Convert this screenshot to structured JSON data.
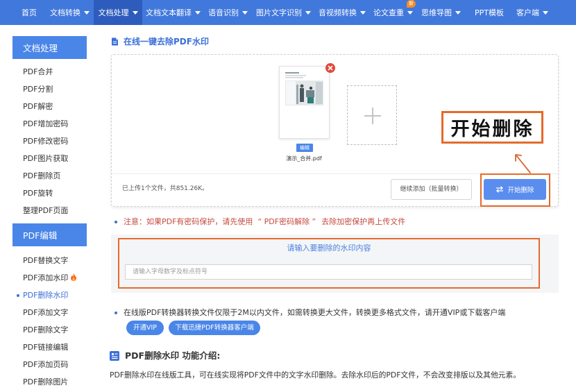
{
  "nav": {
    "items": [
      {
        "label": "首页",
        "dropdown": false
      },
      {
        "label": "文档转换",
        "dropdown": true
      },
      {
        "label": "文档处理",
        "dropdown": true,
        "active": true
      },
      {
        "label": "文档文本翻译",
        "dropdown": true
      },
      {
        "label": "语音识别",
        "dropdown": true
      },
      {
        "label": "图片文字识别",
        "dropdown": true
      },
      {
        "label": "音视频转换",
        "dropdown": true
      },
      {
        "label": "论文查重",
        "dropdown": true,
        "badge": "新"
      },
      {
        "label": "思维导图",
        "dropdown": true
      },
      {
        "label": "PPT模板",
        "dropdown": false
      },
      {
        "label": "客户端",
        "dropdown": true
      }
    ]
  },
  "sidebar": {
    "sections": [
      {
        "title": "文档处理",
        "items": [
          {
            "label": "PDF合并"
          },
          {
            "label": "PDF分割"
          },
          {
            "label": "PDF解密"
          },
          {
            "label": "PDF增加密码"
          },
          {
            "label": "PDF修改密码"
          },
          {
            "label": "PDF图片获取"
          },
          {
            "label": "PDF删除页"
          },
          {
            "label": "PDF旋转"
          },
          {
            "label": "整理PDF页面"
          }
        ]
      },
      {
        "title": "PDF编辑",
        "items": [
          {
            "label": "PDF替换文字"
          },
          {
            "label": "PDF添加水印",
            "icon": "fire-icon"
          },
          {
            "label": "PDF删除水印",
            "active": true
          },
          {
            "label": "PDF添加文字"
          },
          {
            "label": "PDF删除文字"
          },
          {
            "label": "PDF链接编辑"
          },
          {
            "label": "PDF添加页码"
          },
          {
            "label": "PDF删除图片"
          }
        ]
      }
    ]
  },
  "page_title": "在线一键去除PDF水印",
  "upload": {
    "file": {
      "name": "演示_合并.pdf",
      "edit_label": "编辑"
    },
    "status": "已上传1个文件，共851.26K。",
    "add_more_label": "继续添加（批量转换）",
    "start_label": "开始删除"
  },
  "annotation": {
    "label": "开始删除"
  },
  "notice": {
    "prefix": "注意：如果PDF有密码保护，请先使用",
    "link": "“ PDF密码解除 ”",
    "suffix": "去除加密保护再上传文件"
  },
  "watermark": {
    "title": "请输入要删除的水印内容",
    "placeholder": "请输入字母数字及标点符号"
  },
  "limit_notice": "在线版PDF转换器转换文件仅限于2M以内文件，如需转换更大文件，转换更多格式文件，请开通VIP或下载客户端",
  "cta": {
    "vip_label": "开通VIP",
    "download_label": "下载迅捷PDF转换器客户端"
  },
  "intro": {
    "heading": "PDF删除水印 功能介绍:",
    "body": "PDF删除水印在线版工具，可在线实现将PDF文件中的文字水印删除。去除水印后的PDF文件，不会改变排版以及其他元素。"
  },
  "colors": {
    "nav": "#4178dc",
    "nav_active": "#2d5cbd",
    "accent": "#4a86e8",
    "highlight": "#e46a2a",
    "notice": "#c44a3e",
    "badge": "#f08c2a",
    "close": "#e04b3c"
  }
}
